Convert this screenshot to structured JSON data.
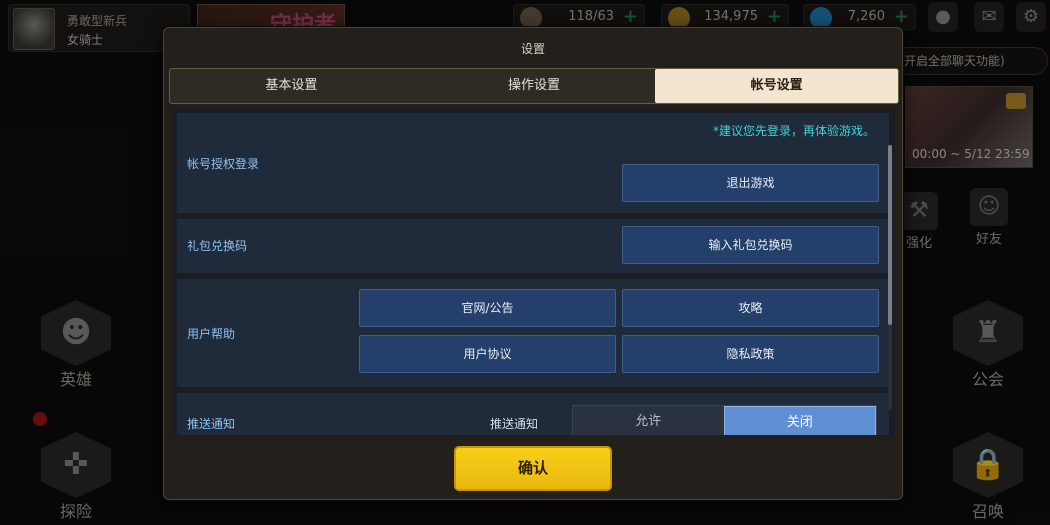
{
  "player": {
    "title": "勇敢型新兵",
    "class": "女骑士"
  },
  "banner": {
    "text": "守护者"
  },
  "resources": [
    {
      "icon": "coffee-icon",
      "value": "118/63",
      "color": "#6b5a48"
    },
    {
      "icon": "gold-coin-icon",
      "value": "134,975",
      "color": "#a07a1e"
    },
    {
      "icon": "gem-icon",
      "value": "7,260",
      "color": "#1f7fb8"
    }
  ],
  "top_icons": [
    "chat-icon",
    "mail-icon",
    "gear-icon"
  ],
  "chat_toggle": {
    "label": "开启全部聊天功能)"
  },
  "event": {
    "time": "00:00 ~ 5/12 23:59"
  },
  "side_buttons": [
    {
      "label": "强化"
    },
    {
      "label": "好友"
    }
  ],
  "big_buttons": {
    "hero": "英雄",
    "explore": "探险",
    "guild": "公会",
    "summon": "召唤"
  },
  "modal": {
    "title": "设置",
    "tabs": [
      {
        "label": "基本设置",
        "active": false
      },
      {
        "label": "操作设置",
        "active": false
      },
      {
        "label": "帐号设置",
        "active": true
      }
    ],
    "account": {
      "label": "帐号授权登录",
      "hint": "*建议您先登录，再体验游戏。",
      "logout_button": "退出游戏"
    },
    "gift": {
      "label": "礼包兑换码",
      "button": "输入礼包兑换码"
    },
    "help": {
      "label": "用户帮助",
      "buttons": [
        "官网/公告",
        "攻略",
        "用户协议",
        "隐私政策"
      ]
    },
    "push": {
      "label": "推送通知",
      "sub_label": "推送通知",
      "options": [
        {
          "label": "允许",
          "selected": false
        },
        {
          "label": "关闭",
          "selected": true
        }
      ]
    },
    "confirm_button": "确认"
  },
  "colors": {
    "accent_yellow": "#f2c414",
    "selected_blue": "#5f8fd3",
    "hint_cyan": "#3fd1d6"
  }
}
